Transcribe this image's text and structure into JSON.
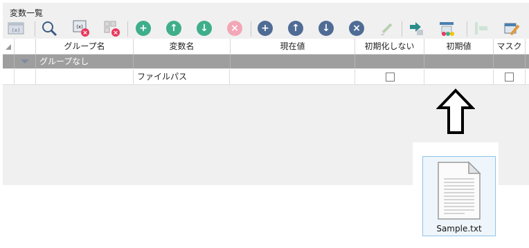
{
  "panel": {
    "title": "変数一覧"
  },
  "toolbar": {
    "buttons": [
      {
        "name": "variable-format-icon",
        "glyph": "(x)"
      },
      {
        "name": "search-icon"
      },
      {
        "name": "delete-variable-icon",
        "glyph": "(x)"
      },
      {
        "name": "delete-unused-icon"
      },
      {
        "name": "add-group-icon",
        "glyph": "+"
      },
      {
        "name": "group-move-up-icon",
        "glyph": "↑"
      },
      {
        "name": "group-move-down-icon",
        "glyph": "↓"
      },
      {
        "name": "delete-group-icon",
        "glyph": "×"
      },
      {
        "name": "add-variable-icon",
        "glyph": "+"
      },
      {
        "name": "variable-move-up-icon",
        "glyph": "↑"
      },
      {
        "name": "variable-move-down-icon",
        "glyph": "↓"
      },
      {
        "name": "delete-variable-row-icon",
        "glyph": "×"
      },
      {
        "name": "edit-icon"
      },
      {
        "name": "import-icon"
      },
      {
        "name": "export-icon"
      },
      {
        "name": "move-icon"
      },
      {
        "name": "settings-icon"
      }
    ]
  },
  "grid": {
    "columns": [
      "",
      "",
      "グループ名",
      "変数名",
      "現在値",
      "初期化しない",
      "初期値",
      "マスク"
    ],
    "group_row": {
      "label": "グループなし"
    },
    "rows": [
      {
        "group": "",
        "name": "ファイルパス",
        "current": "",
        "no_init": false,
        "initial": "",
        "mask": false
      }
    ]
  },
  "file": {
    "name": "Sample.txt"
  },
  "annotation": {
    "arrow": "up-arrow"
  }
}
